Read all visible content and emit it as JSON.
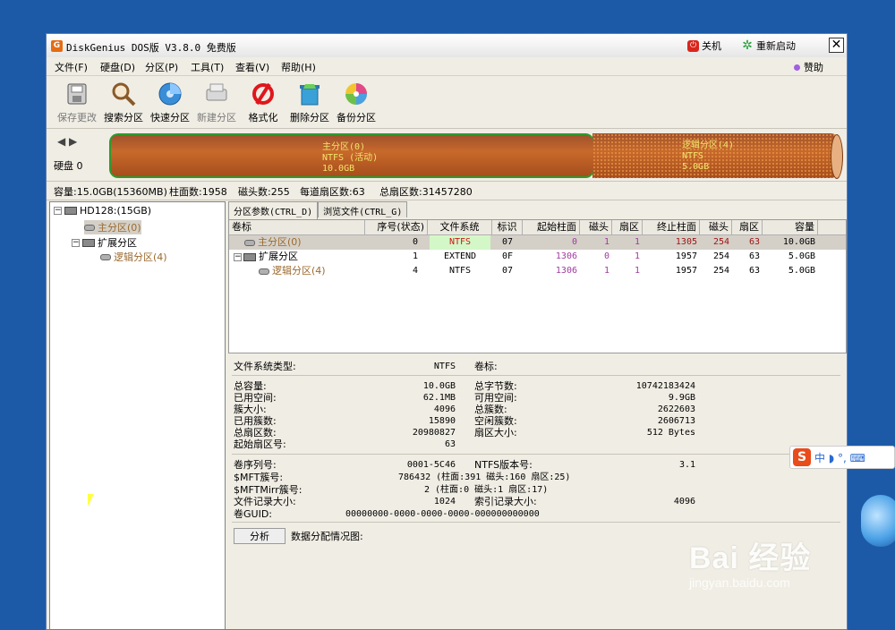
{
  "window": {
    "app_icon": "G",
    "title": "DiskGenius DOS版 V3.8.0 免费版",
    "shutdown_label": "关机",
    "restart_label": "重新启动",
    "close_glyph": "✕"
  },
  "menu": {
    "items": [
      "文件(F)",
      "硬盘(D)",
      "分区(P)",
      "工具(T)",
      "查看(V)",
      "帮助(H)"
    ],
    "sponsor": "赞助"
  },
  "toolbar": {
    "items": [
      {
        "label": "保存更改",
        "icon": "save-icon"
      },
      {
        "label": "搜索分区",
        "icon": "search-icon"
      },
      {
        "label": "快速分区",
        "icon": "quick-partition-icon"
      },
      {
        "label": "新建分区",
        "icon": "new-partition-icon"
      },
      {
        "label": "格式化",
        "icon": "format-icon"
      },
      {
        "label": "删除分区",
        "icon": "delete-icon"
      },
      {
        "label": "备份分区",
        "icon": "backup-icon"
      }
    ]
  },
  "diskbar": {
    "nav_glyphs": "◀ ▶",
    "disk_label": "硬盘 0",
    "primary": {
      "name": "主分区(0)",
      "fs": "NTFS (活动)",
      "size": "10.0GB"
    },
    "logical": {
      "name": "逻辑分区(4)",
      "fs": "NTFS",
      "size": "5.0GB"
    }
  },
  "diskinfo": {
    "capacity": "容量:15.0GB(15360MB)",
    "cylinders": "柱面数:1958",
    "heads": "磁头数:255",
    "sectors_per_track": "每道扇区数:63",
    "total_sectors": "总扇区数:31457280"
  },
  "tree": {
    "disk": "HD128:(15GB)",
    "primary": "主分区(0)",
    "extended": "扩展分区",
    "logical": "逻辑分区(4)"
  },
  "tabs": [
    "分区参数(CTRL_D)",
    "浏览文件(CTRL_G)"
  ],
  "table": {
    "headers": [
      "卷标",
      "序号(状态)",
      "文件系统",
      "标识",
      "起始柱面",
      "磁头",
      "扇区",
      "终止柱面",
      "磁头",
      "扇区",
      "容量"
    ],
    "rows": [
      {
        "name": "主分区(0)",
        "seq": "0",
        "fs": "NTFS",
        "id": "07",
        "start_cyl": "0",
        "start_head": "1",
        "start_sec": "1",
        "end_cyl": "1305",
        "end_head": "254",
        "end_sec": "63",
        "size": "10.0GB"
      },
      {
        "name": "扩展分区",
        "seq": "1",
        "fs": "EXTEND",
        "id": "0F",
        "start_cyl": "1306",
        "start_head": "0",
        "start_sec": "1",
        "end_cyl": "1957",
        "end_head": "254",
        "end_sec": "63",
        "size": "5.0GB"
      },
      {
        "name": "逻辑分区(4)",
        "seq": "4",
        "fs": "NTFS",
        "id": "07",
        "start_cyl": "1306",
        "start_head": "1",
        "start_sec": "1",
        "end_cyl": "1957",
        "end_head": "254",
        "end_sec": "63",
        "size": "5.0GB"
      }
    ]
  },
  "details": {
    "fs_type_label": "文件系统类型:",
    "fs_type_value": "NTFS",
    "volume_label": "卷标:",
    "left": [
      {
        "label": "总容量:",
        "value": "10.0GB"
      },
      {
        "label": "已用空间:",
        "value": "62.1MB"
      },
      {
        "label": "簇大小:",
        "value": "4096"
      },
      {
        "label": "已用簇数:",
        "value": "15890"
      },
      {
        "label": "总扇区数:",
        "value": "20980827"
      },
      {
        "label": "起始扇区号:",
        "value": "63"
      }
    ],
    "right": [
      {
        "label": "总字节数:",
        "value": "10742183424"
      },
      {
        "label": "可用空间:",
        "value": "9.9GB"
      },
      {
        "label": "总簇数:",
        "value": "2622603"
      },
      {
        "label": "空闲簇数:",
        "value": "2606713"
      },
      {
        "label": "扇区大小:",
        "value": "512 Bytes"
      }
    ],
    "serial_label": "卷序列号:",
    "serial_value": "0001-5C46",
    "ntfs_ver_label": "NTFS版本号:",
    "ntfs_ver_value": "3.1",
    "mft_label": "$MFT簇号:",
    "mft_value": "786432 (柱面:391 磁头:160 扇区:25)",
    "mftmirr_label": "$MFTMirr簇号:",
    "mftmirr_value": "2 (柱面:0 磁头:1 扇区:17)",
    "record_size_label": "文件记录大小:",
    "record_size_value": "1024",
    "index_size_label": "索引记录大小:",
    "index_size_value": "4096",
    "guid_label": "卷GUID:",
    "guid_value": "00000000-0000-0000-0000-000000000000",
    "analyze_btn": "分析",
    "alloc_label": "数据分配情况图:"
  },
  "ime": {
    "logo": "S",
    "text": "中 ◗ °, ⌨"
  },
  "watermark": {
    "main": "Bai 经验",
    "sub": "jingyan.baidu.com"
  },
  "colors": {
    "accent_fs": "#d4f7c8",
    "selected_row": "#d4d0c8",
    "partition_text": "#f3e36a",
    "tree_selected": "#9c6a2e"
  }
}
